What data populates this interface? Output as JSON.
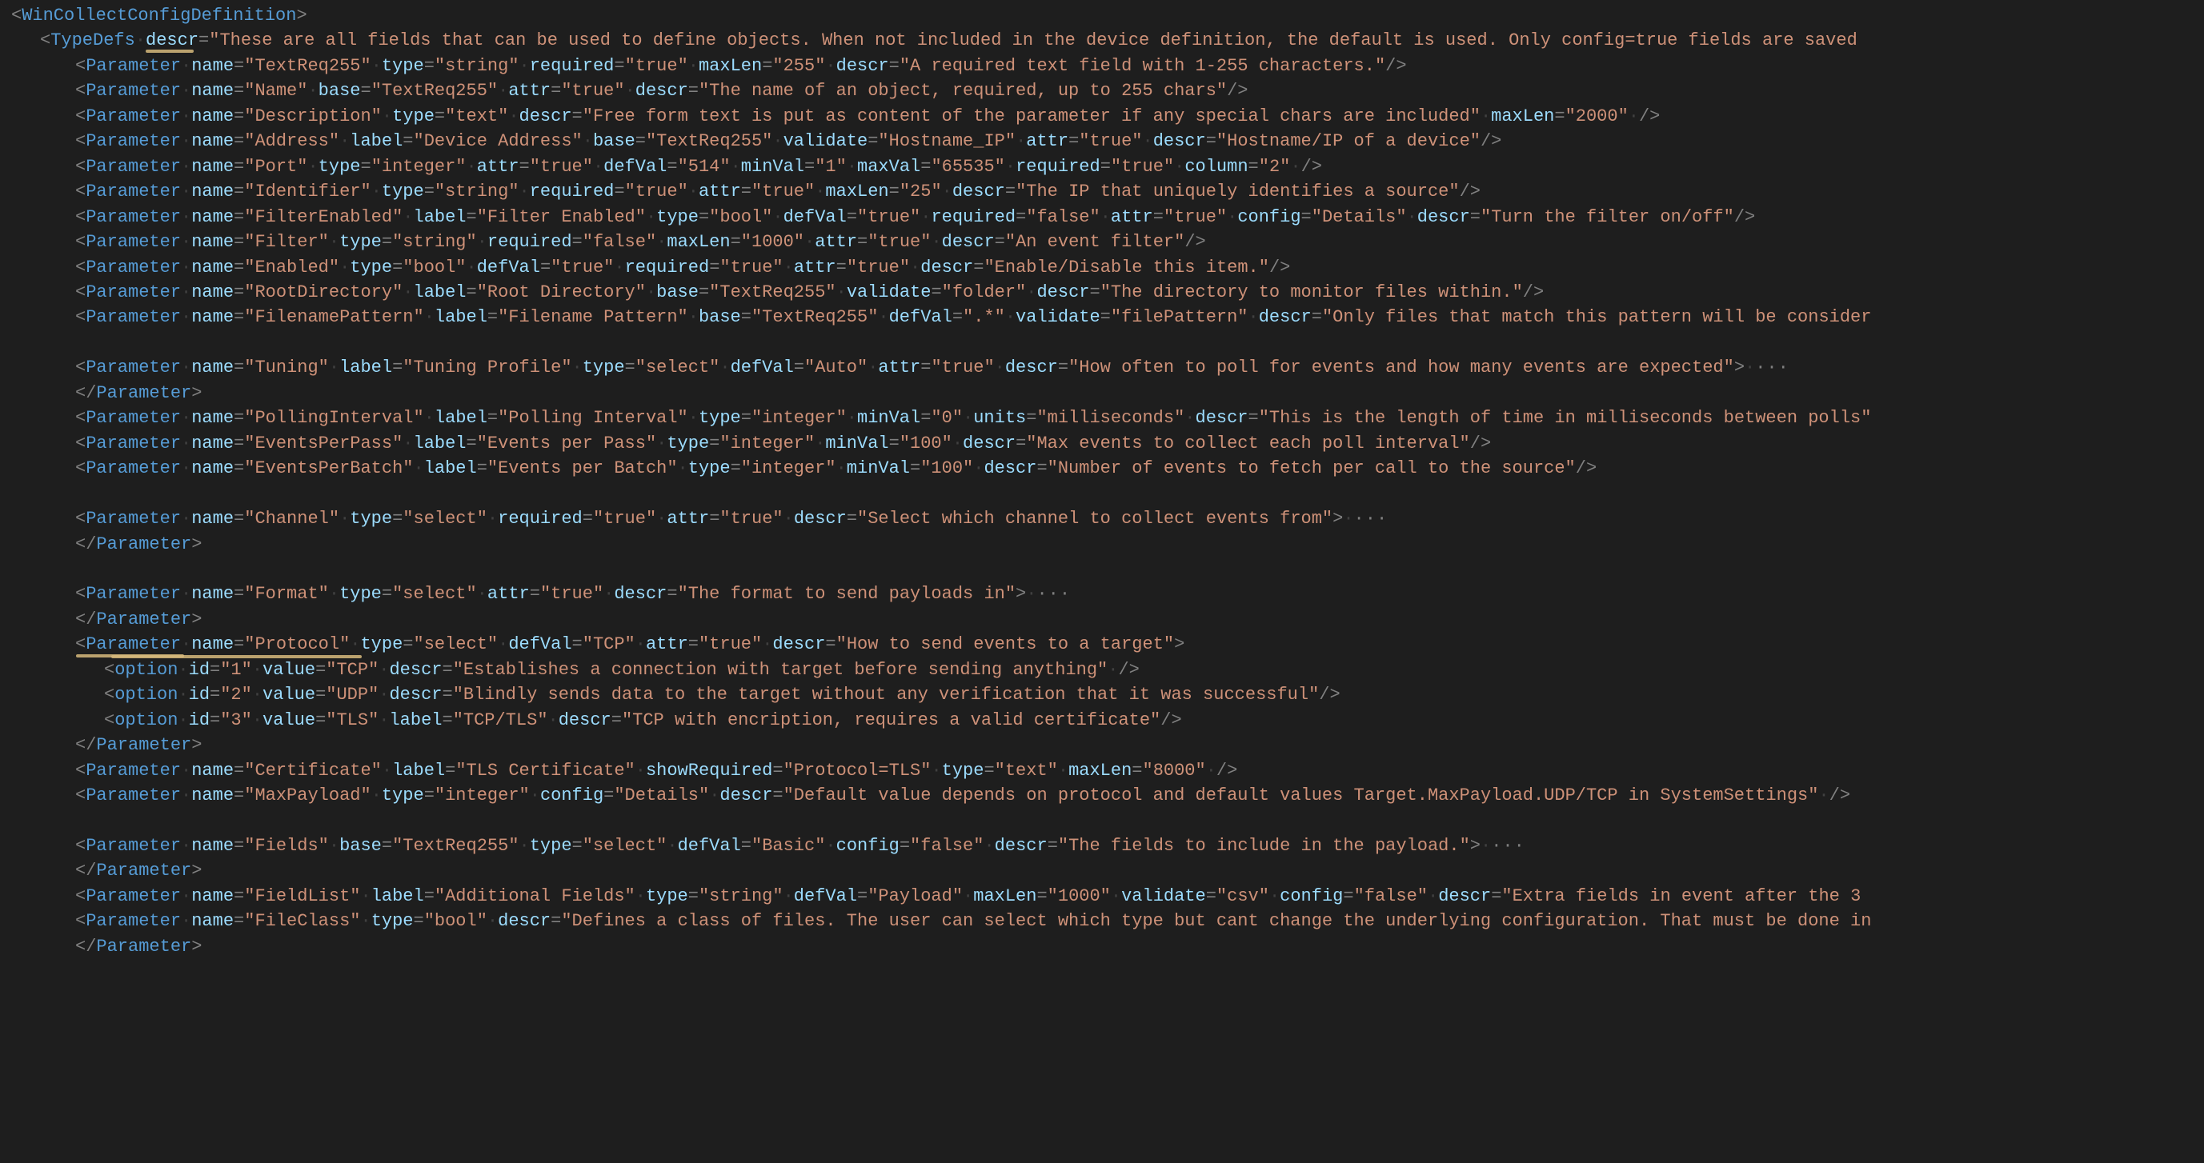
{
  "root": {
    "open": "<",
    "name": "WinCollectConfigDefinition",
    "close": ">"
  },
  "typedefs": {
    "open": "<",
    "name": "TypeDefs",
    "a1": {
      "n": "descr",
      "v": "\"These are all fields that can be used to define objects.  When not included in the device definition, the default is used. Only config=true fields are saved "
    }
  },
  "hl1": "descr",
  "hl2": "Parameter",
  "p": [
    {
      "attrs": [
        [
          "name",
          "\"TextReq255\""
        ],
        [
          "type",
          "\"string\""
        ],
        [
          "required",
          "\"true\""
        ],
        [
          "maxLen",
          "\"255\""
        ],
        [
          "descr",
          "\"A required text field with 1-255 characters.\""
        ]
      ],
      "self": true
    },
    {
      "attrs": [
        [
          "name",
          "\"Name\""
        ],
        [
          "base",
          "\"TextReq255\""
        ],
        [
          "attr",
          "\"true\""
        ],
        [
          "descr",
          "\"The name of an object, required, up to 255 chars\""
        ]
      ],
      "self": true
    },
    {
      "attrs": [
        [
          "name",
          "\"Description\""
        ],
        [
          "type",
          "\"text\""
        ],
        [
          "descr",
          "\"Free form text is put as content of the parameter if any special chars are included\""
        ],
        [
          "maxLen",
          "\"2000\""
        ]
      ],
      "self": true,
      "sp": true
    },
    {
      "attrs": [
        [
          "name",
          "\"Address\""
        ],
        [
          "label",
          "\"Device Address\""
        ],
        [
          "base",
          "\"TextReq255\""
        ],
        [
          "validate",
          "\"Hostname_IP\""
        ],
        [
          "attr",
          "\"true\""
        ],
        [
          "descr",
          "\"Hostname/IP of a device\""
        ]
      ],
      "self": true
    },
    {
      "attrs": [
        [
          "name",
          "\"Port\""
        ],
        [
          "type",
          "\"integer\""
        ],
        [
          "attr",
          "\"true\""
        ],
        [
          "defVal",
          "\"514\""
        ],
        [
          "minVal",
          "\"1\""
        ],
        [
          "maxVal",
          "\"65535\""
        ],
        [
          "required",
          "\"true\""
        ],
        [
          "column",
          "\"2\""
        ]
      ],
      "self": true,
      "sp": true
    },
    {
      "attrs": [
        [
          "name",
          "\"Identifier\""
        ],
        [
          "type",
          "\"string\""
        ],
        [
          "required",
          "\"true\""
        ],
        [
          "attr",
          "\"true\""
        ],
        [
          "maxLen",
          "\"25\""
        ],
        [
          "descr",
          "\"The IP that uniquely identifies a source\""
        ]
      ],
      "self": true
    },
    {
      "attrs": [
        [
          "name",
          "\"FilterEnabled\""
        ],
        [
          "label",
          "\"Filter Enabled\""
        ],
        [
          "type",
          "\"bool\""
        ],
        [
          "defVal",
          "\"true\""
        ],
        [
          "required",
          "\"false\""
        ],
        [
          "attr",
          "\"true\""
        ],
        [
          "config",
          "\"Details\""
        ],
        [
          "descr",
          "\"Turn the filter on/off\""
        ]
      ],
      "self": true
    },
    {
      "attrs": [
        [
          "name",
          "\"Filter\""
        ],
        [
          "type",
          "\"string\""
        ],
        [
          "required",
          "\"false\""
        ],
        [
          "maxLen",
          "\"1000\""
        ],
        [
          "attr",
          "\"true\""
        ],
        [
          "descr",
          "\"An event filter\""
        ]
      ],
      "self": true
    },
    {
      "attrs": [
        [
          "name",
          "\"Enabled\""
        ],
        [
          "type",
          "\"bool\""
        ],
        [
          "defVal",
          "\"true\""
        ],
        [
          "required",
          "\"true\""
        ],
        [
          "attr",
          "\"true\""
        ],
        [
          "descr",
          "\"Enable/Disable this item.\""
        ]
      ],
      "self": true
    },
    {
      "attrs": [
        [
          "name",
          "\"RootDirectory\""
        ],
        [
          "label",
          "\"Root Directory\""
        ],
        [
          "base",
          "\"TextReq255\""
        ],
        [
          "validate",
          "\"folder\""
        ],
        [
          "descr",
          "\"The directory to monitor files within.\""
        ]
      ],
      "self": true
    },
    {
      "attrs": [
        [
          "name",
          "\"FilenamePattern\""
        ],
        [
          "label",
          "\"Filename Pattern\""
        ],
        [
          "base",
          "\"TextReq255\""
        ],
        [
          "defVal",
          "\".*\""
        ],
        [
          "validate",
          "\"filePattern\""
        ],
        [
          "descr",
          "\"Only files that match this pattern will be consider"
        ]
      ],
      "self": false,
      "noclose": true
    },
    {
      "blank": true
    },
    {
      "attrs": [
        [
          "name",
          "\"Tuning\""
        ],
        [
          "label",
          "\"Tuning Profile\""
        ],
        [
          "type",
          "\"select\""
        ],
        [
          "defVal",
          "\"Auto\""
        ],
        [
          "attr",
          "\"true\""
        ],
        [
          "descr",
          "\"How often to poll for events and how many events are expected\""
        ]
      ],
      "fold": true
    },
    {
      "close": true
    },
    {
      "attrs": [
        [
          "name",
          "\"PollingInterval\""
        ],
        [
          "label",
          "\"Polling Interval\""
        ],
        [
          "type",
          "\"integer\""
        ],
        [
          "minVal",
          "\"0\""
        ],
        [
          "units",
          "\"milliseconds\""
        ],
        [
          "descr",
          "\"This is the length of time in milliseconds between polls\""
        ]
      ],
      "self": false,
      "noclose": true
    },
    {
      "attrs": [
        [
          "name",
          "\"EventsPerPass\""
        ],
        [
          "label",
          "\"Events per Pass\""
        ],
        [
          "type",
          "\"integer\""
        ],
        [
          "minVal",
          "\"100\""
        ],
        [
          "descr",
          "\"Max events to collect each poll interval\""
        ]
      ],
      "self": true
    },
    {
      "attrs": [
        [
          "name",
          "\"EventsPerBatch\""
        ],
        [
          "label",
          "\"Events per Batch\""
        ],
        [
          "type",
          "\"integer\""
        ],
        [
          "minVal",
          "\"100\""
        ],
        [
          "descr",
          "\"Number of events to fetch per call to the source\""
        ]
      ],
      "self": true
    },
    {
      "blank": true
    },
    {
      "attrs": [
        [
          "name",
          "\"Channel\""
        ],
        [
          "type",
          "\"select\""
        ],
        [
          "required",
          "\"true\""
        ],
        [
          "attr",
          "\"true\""
        ],
        [
          "descr",
          "\"Select which channel to collect events from\""
        ]
      ],
      "fold": true
    },
    {
      "close": true
    },
    {
      "blank": true
    },
    {
      "attrs": [
        [
          "name",
          "\"Format\""
        ],
        [
          "type",
          "\"select\""
        ],
        [
          "attr",
          "\"true\""
        ],
        [
          "descr",
          "\"The format to send payloads in\""
        ]
      ],
      "fold": true
    },
    {
      "close": true
    },
    {
      "attrs": [
        [
          "name",
          "\"Protocol\""
        ],
        [
          "type",
          "\"select\""
        ],
        [
          "defVal",
          "\"TCP\""
        ],
        [
          "attr",
          "\"true\""
        ],
        [
          "descr",
          "\"How to send events to a target\""
        ]
      ],
      "open": true,
      "hl": true
    },
    {
      "opt": true,
      "first": true,
      "attrs": [
        [
          "id",
          "\"1\""
        ],
        [
          "value",
          "\"TCP\""
        ],
        [
          "descr",
          "\"Establishes a connection with target before sending anything\""
        ]
      ]
    },
    {
      "opt": true,
      "attrs": [
        [
          "id",
          "\"2\""
        ],
        [
          "value",
          "\"UDP\""
        ],
        [
          "descr",
          "\"Blindly sends data to the target without any verification that it was successful\""
        ]
      ]
    },
    {
      "opt": true,
      "attrs": [
        [
          "id",
          "\"3\""
        ],
        [
          "value",
          "\"TLS\""
        ],
        [
          "label",
          "\"TCP/TLS\""
        ],
        [
          "descr",
          "\"TCP with encription, requires a valid certificate\""
        ]
      ]
    },
    {
      "close": true
    },
    {
      "attrs": [
        [
          "name",
          "\"Certificate\""
        ],
        [
          "label",
          "\"TLS Certificate\""
        ],
        [
          "showRequired",
          "\"Protocol=TLS\""
        ],
        [
          "type",
          "\"text\""
        ],
        [
          "maxLen",
          "\"8000\""
        ]
      ],
      "self": true,
      "sp": true
    },
    {
      "attrs": [
        [
          "name",
          "\"MaxPayload\""
        ],
        [
          "type",
          "\"integer\""
        ],
        [
          "config",
          "\"Details\""
        ],
        [
          "descr",
          "\"Default value depends on protocol and default values Target.MaxPayload.UDP/TCP in SystemSettings\""
        ]
      ],
      "self": true,
      "sp": true
    },
    {
      "blank": true
    },
    {
      "attrs": [
        [
          "name",
          "\"Fields\""
        ],
        [
          "base",
          "\"TextReq255\""
        ],
        [
          "type",
          "\"select\""
        ],
        [
          "defVal",
          "\"Basic\""
        ],
        [
          "config",
          "\"false\""
        ],
        [
          "descr",
          "\"The fields to include in the payload.\""
        ]
      ],
      "fold": true
    },
    {
      "close": true
    },
    {
      "attrs": [
        [
          "name",
          "\"FieldList\""
        ],
        [
          "label",
          "\"Additional Fields\""
        ],
        [
          "type",
          "\"string\""
        ],
        [
          "defVal",
          "\"Payload\""
        ],
        [
          "maxLen",
          "\"1000\""
        ],
        [
          "validate",
          "\"csv\""
        ],
        [
          "config",
          "\"false\""
        ],
        [
          "descr",
          "\"Extra fields in event after the 3 "
        ]
      ],
      "self": false,
      "noclose": true
    },
    {
      "attrs": [
        [
          "name",
          "\"FileClass\""
        ],
        [
          "type",
          "\"bool\""
        ],
        [
          "descr",
          "\"Defines a class of files. The user can select which type but cant change the underlying configuration. That must be done in "
        ]
      ],
      "self": false,
      "noclose": true
    },
    {
      "close": true
    }
  ],
  "close_tag": {
    "open": "</",
    "name": "Parameter",
    "close": ">"
  }
}
